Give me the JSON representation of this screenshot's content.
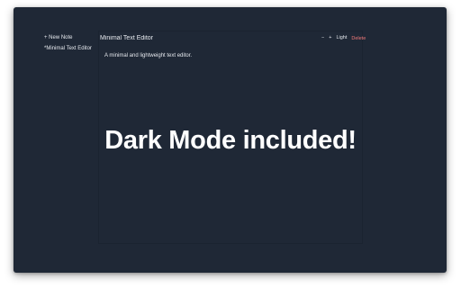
{
  "sidebar": {
    "new_note_label": "+ New Note",
    "notes": [
      {
        "title": "*Minimal Text Editor"
      }
    ]
  },
  "editor": {
    "title_value": "Minimal Text Editor",
    "body_text": "A minimal and lightweight text editor."
  },
  "toolbar": {
    "zoom_out_label": "−",
    "zoom_in_label": "+",
    "theme_label": "Light",
    "delete_label": "Delete"
  },
  "overlay": {
    "headline": "Dark Mode included!"
  },
  "colors": {
    "background": "#1f2836",
    "text": "#e6e9ee",
    "delete": "#f07a7a"
  }
}
